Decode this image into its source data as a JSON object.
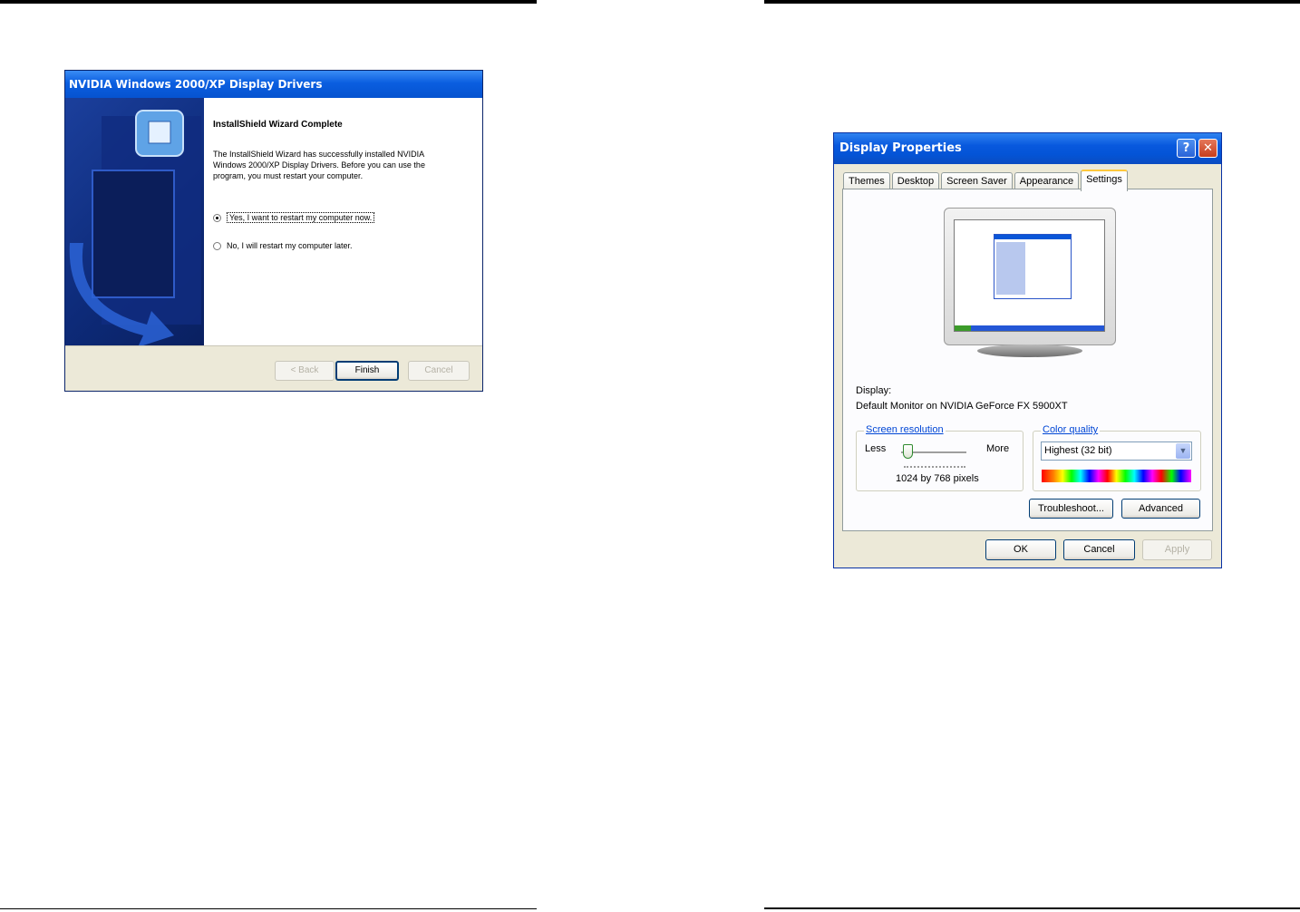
{
  "wizard": {
    "title": "NVIDIA Windows 2000/XP Display Drivers",
    "heading": "InstallShield Wizard Complete",
    "body": "The InstallShield Wizard has successfully installed NVIDIA Windows 2000/XP Display Drivers. Before you can use the program, you must restart your computer.",
    "option_restart_now": "Yes, I want to restart my computer now.",
    "option_restart_later": "No, I will restart my computer later.",
    "selected_option": "restart_now",
    "buttons": {
      "back": "< Back",
      "finish": "Finish",
      "cancel": "Cancel"
    }
  },
  "display_properties": {
    "title": "Display Properties",
    "title_buttons": {
      "help": "?",
      "close": "✕"
    },
    "tabs": [
      {
        "label": "Themes"
      },
      {
        "label": "Desktop"
      },
      {
        "label": "Screen Saver"
      },
      {
        "label": "Appearance"
      },
      {
        "label": "Settings"
      }
    ],
    "active_tab": "Settings",
    "display_label": "Display:",
    "display_value": "Default Monitor on NVIDIA GeForce FX 5900XT",
    "screen_resolution": {
      "title": "Screen resolution",
      "less": "Less",
      "more": "More",
      "value": "1024 by 768 pixels"
    },
    "color_quality": {
      "title": "Color quality",
      "selected": "Highest (32 bit)"
    },
    "buttons": {
      "troubleshoot": "Troubleshoot...",
      "advanced": "Advanced",
      "ok": "OK",
      "cancel": "Cancel",
      "apply": "Apply"
    }
  }
}
